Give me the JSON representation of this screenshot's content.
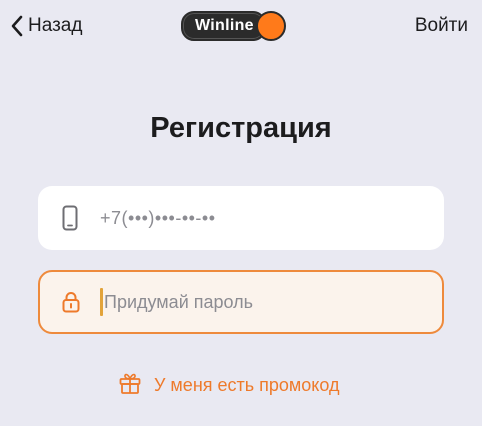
{
  "header": {
    "back_label": "Назад",
    "logo_text": "Winline",
    "login_label": "Войти"
  },
  "title": "Регистрация",
  "phone": {
    "value": "+7(•••)•••-••-••"
  },
  "password": {
    "placeholder": "Придумай пароль"
  },
  "promo": {
    "label": "У меня есть промокод"
  },
  "colors": {
    "accent": "#ee7a2b",
    "background": "#e9e9f2",
    "logo_dot": "#ff7a1a"
  },
  "icons": {
    "back": "chevron-left-icon",
    "phone": "phone-icon",
    "password": "lock-icon",
    "promo": "gift-icon"
  }
}
